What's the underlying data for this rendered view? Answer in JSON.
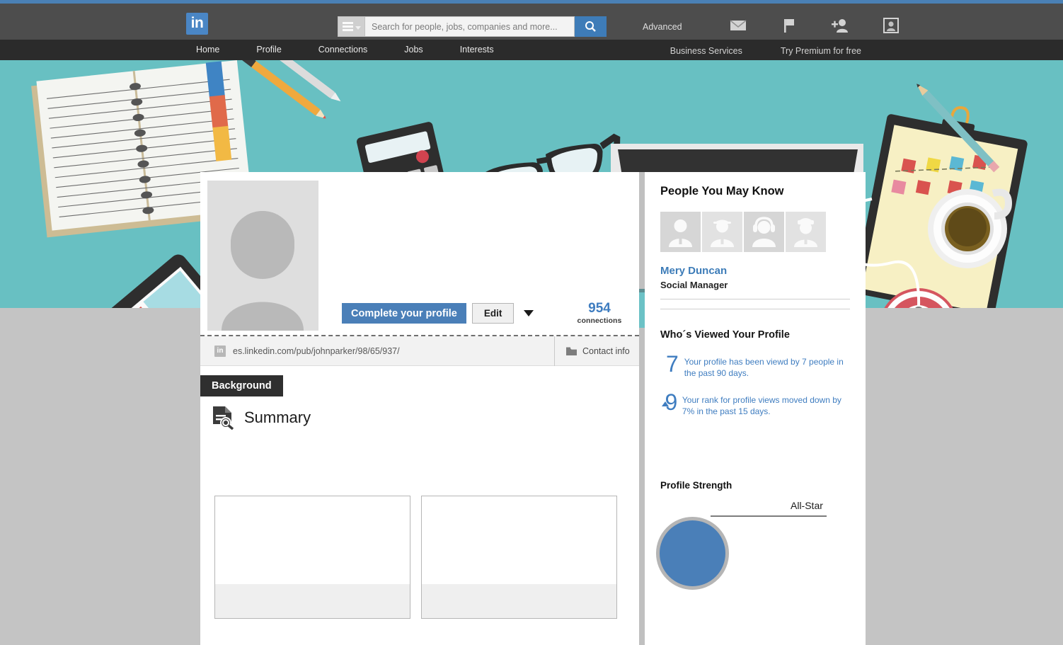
{
  "theme": {
    "linkedin_blue": "#4a86c5",
    "header_gray": "#4d4d4d",
    "nav_dark": "#2b2b2b",
    "banner_teal": "#68c0c2",
    "page_gray": "#c4c4c4",
    "accent_blue": "#3f7dc0"
  },
  "header": {
    "logo_text": "in",
    "search": {
      "placeholder": "Search for people, jobs, companies and more...",
      "value": "",
      "category_icon": "hamburger-menu-icon",
      "submit_icon": "search-icon"
    },
    "advanced_label": "Advanced",
    "icons": [
      {
        "name": "messages-icon",
        "glyph": "envelope"
      },
      {
        "name": "notifications-flag-icon",
        "glyph": "flag"
      },
      {
        "name": "add-connection-icon",
        "glyph": "person-plus"
      },
      {
        "name": "profile-avatar-icon",
        "glyph": "person-framed"
      }
    ]
  },
  "nav": {
    "items": [
      {
        "label": "Home"
      },
      {
        "label": "Profile"
      },
      {
        "label": "Connections"
      },
      {
        "label": "Jobs"
      },
      {
        "label": "Interests"
      }
    ],
    "right_items": [
      {
        "label": "Business Services"
      },
      {
        "label": "Try Premium for free"
      }
    ]
  },
  "profile": {
    "avatar": "default-person-placeholder",
    "complete_button": "Complete your profile",
    "edit_button": "Edit",
    "edit_dropdown_icon": "chevron-down-icon",
    "connections_count": "954",
    "connections_label": "connections",
    "public_url": "es.linkedin.com/pub/johnparker/98/65/937/",
    "url_icon": "linkedin-badge-icon",
    "contact_info_label": "Contact info",
    "contact_info_icon": "contact-card-icon",
    "background_tab": "Background",
    "summary_heading": "Summary",
    "summary_icon": "document-search-icon",
    "content_cards": [
      {
        "name": "content-card-1"
      },
      {
        "name": "content-card-2"
      }
    ]
  },
  "sidebar": {
    "pymk": {
      "title": "People You May Know",
      "thumbnails": [
        {
          "name": "person-tie-avatar"
        },
        {
          "name": "person-hardhat-avatar"
        },
        {
          "name": "person-headset-avatar"
        },
        {
          "name": "person-cap-avatar"
        }
      ],
      "person_name": "Mery Duncan",
      "person_role": "Social Manager"
    },
    "viewers": {
      "title": "Who´s Viewed Your Profile",
      "stats": [
        {
          "number": "7",
          "text": "Your profile has been viewd by 7 people in the past 90 days.",
          "has_arrow": false
        },
        {
          "number": "9",
          "text": "Your rank for profile views moved down by 7% in the past 15 days.",
          "has_arrow": true
        }
      ]
    },
    "strength": {
      "title": "Profile Strength",
      "level_label": "All-Star"
    }
  }
}
